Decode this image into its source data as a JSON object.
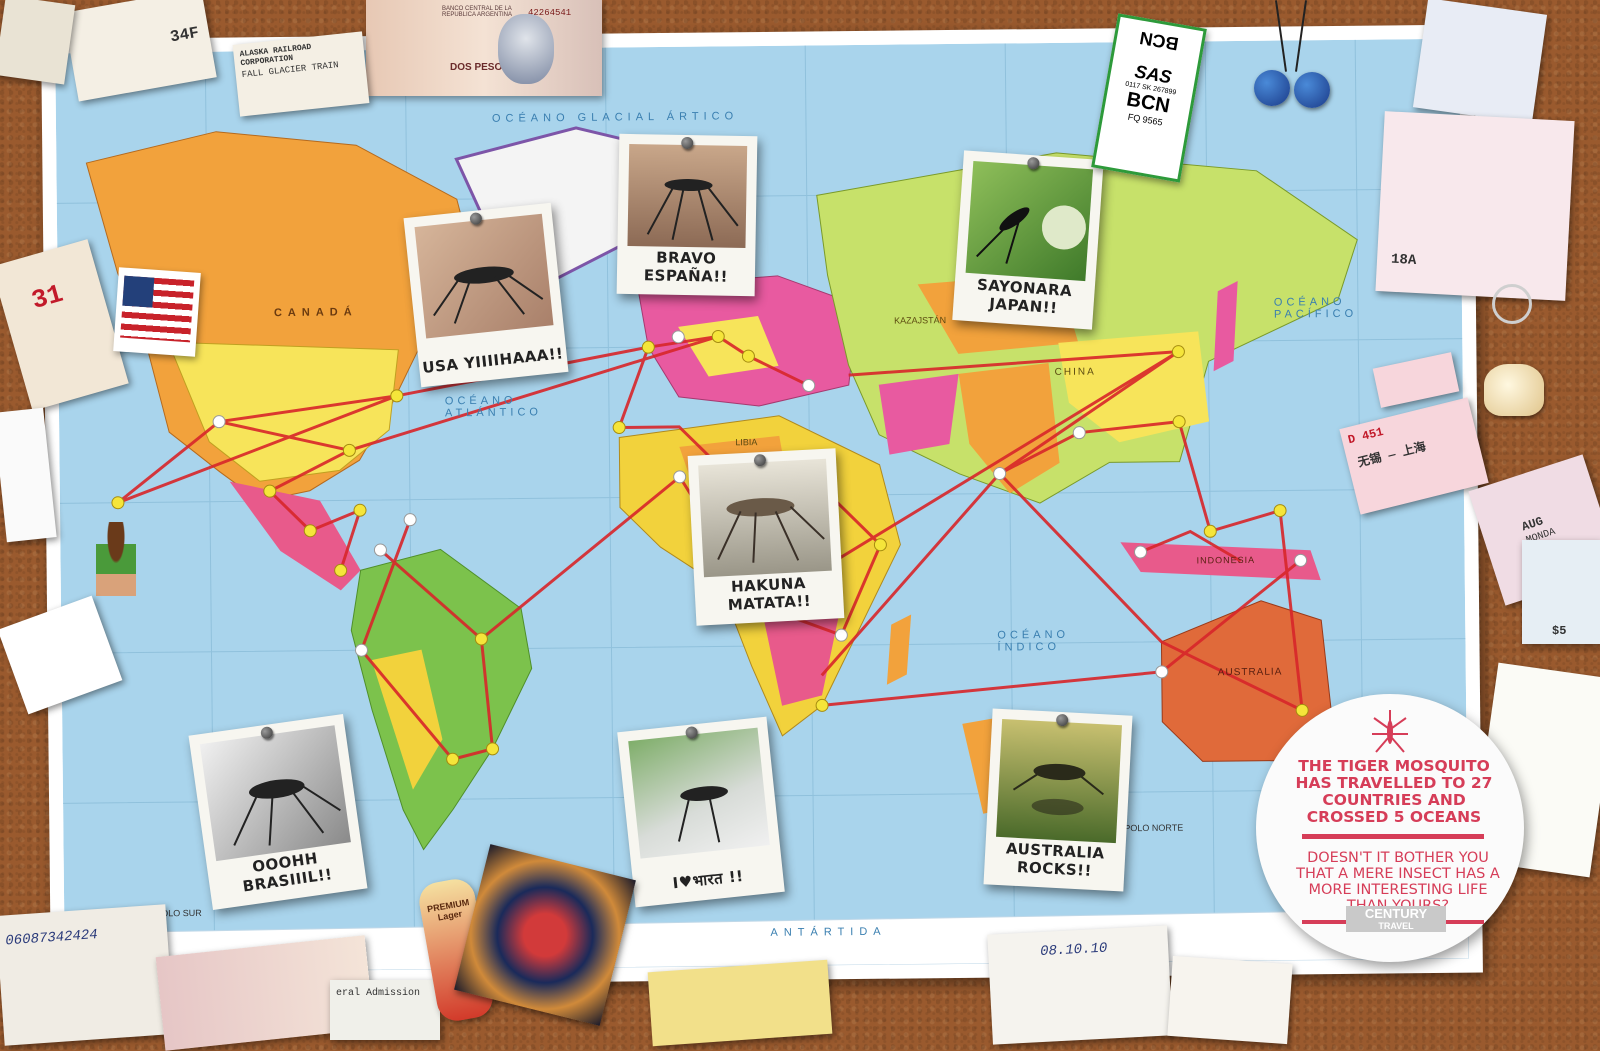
{
  "map": {
    "ocean_labels": [
      {
        "text": "OCÉANO GLACIAL ÁRTICO"
      },
      {
        "text": "OCÉANO PACÍFICO"
      },
      {
        "text": "OCÉANO ATLÁNTICO"
      },
      {
        "text": "OCÉANO ÍNDICO"
      },
      {
        "text": "ANTÁRTIDA"
      },
      {
        "text": "CANADÁ"
      },
      {
        "text": "CHINA"
      },
      {
        "text": "AUSTRALIA"
      },
      {
        "text": "INDONESIA"
      },
      {
        "text": "KAZAJSTÁN"
      },
      {
        "text": "LIBIA"
      },
      {
        "text": "POLO SUR"
      },
      {
        "text": "POLO NORTE"
      }
    ]
  },
  "photos": {
    "usa": "USA YIIIIHAAA!!",
    "spain": "BRAVO ESPAÑA!!",
    "japan": "SAYONARA JAPAN!!",
    "africa": "HAKUNA MATATA!!",
    "brazil": "OOOHH BRASIIIL!!",
    "india": "I♥भारत !!",
    "australia": "AUSTRALIA ROCKS!!"
  },
  "ad": {
    "headline": "THE TIGER MOSQUITO HAS TRAVELLED TO 27 COUNTRIES AND CROSSED 5 OCEANS",
    "subline": "DOESN'T IT BOTHER YOU THAT A MERE INSECT HAS A MORE INTERESTING LIFE THAN YOURS?",
    "brand_line1": "CENTURY",
    "brand_line2": "TRAVEL",
    "accent_color": "#d63d58"
  },
  "ephemera": {
    "banknote_left": "DOS PESOS",
    "banknote_bank": "BANCO CENTRAL DE LA REPUBLICA ARGENTINA",
    "banknote_serial": "42264541",
    "rail_ticket": "ALASKA RAILROAD CORPORATION",
    "rail_ticket_sub": "FALL GLACIER TRAIN",
    "boarding_seat": "34F",
    "bag_tag_top": "BCN",
    "bag_tag_airline": "SAS",
    "bag_tag_bottom": "BCN",
    "bag_tag_flight": "FQ 9565",
    "bag_tag_num": "0117 SK 267899",
    "calendar_day": "31",
    "cn_ticket": "D 451",
    "cn_ticket_route": "无锡 — 上海",
    "seat_18a": "18A",
    "receipt_number": "06087342424",
    "receipt_date": "08.10.10",
    "ticket_aug": "AUG",
    "ticket_monday": "MONDA",
    "beer_label": "PREMIUM Lager",
    "general_admission": "eral Admission",
    "price": "$5"
  }
}
